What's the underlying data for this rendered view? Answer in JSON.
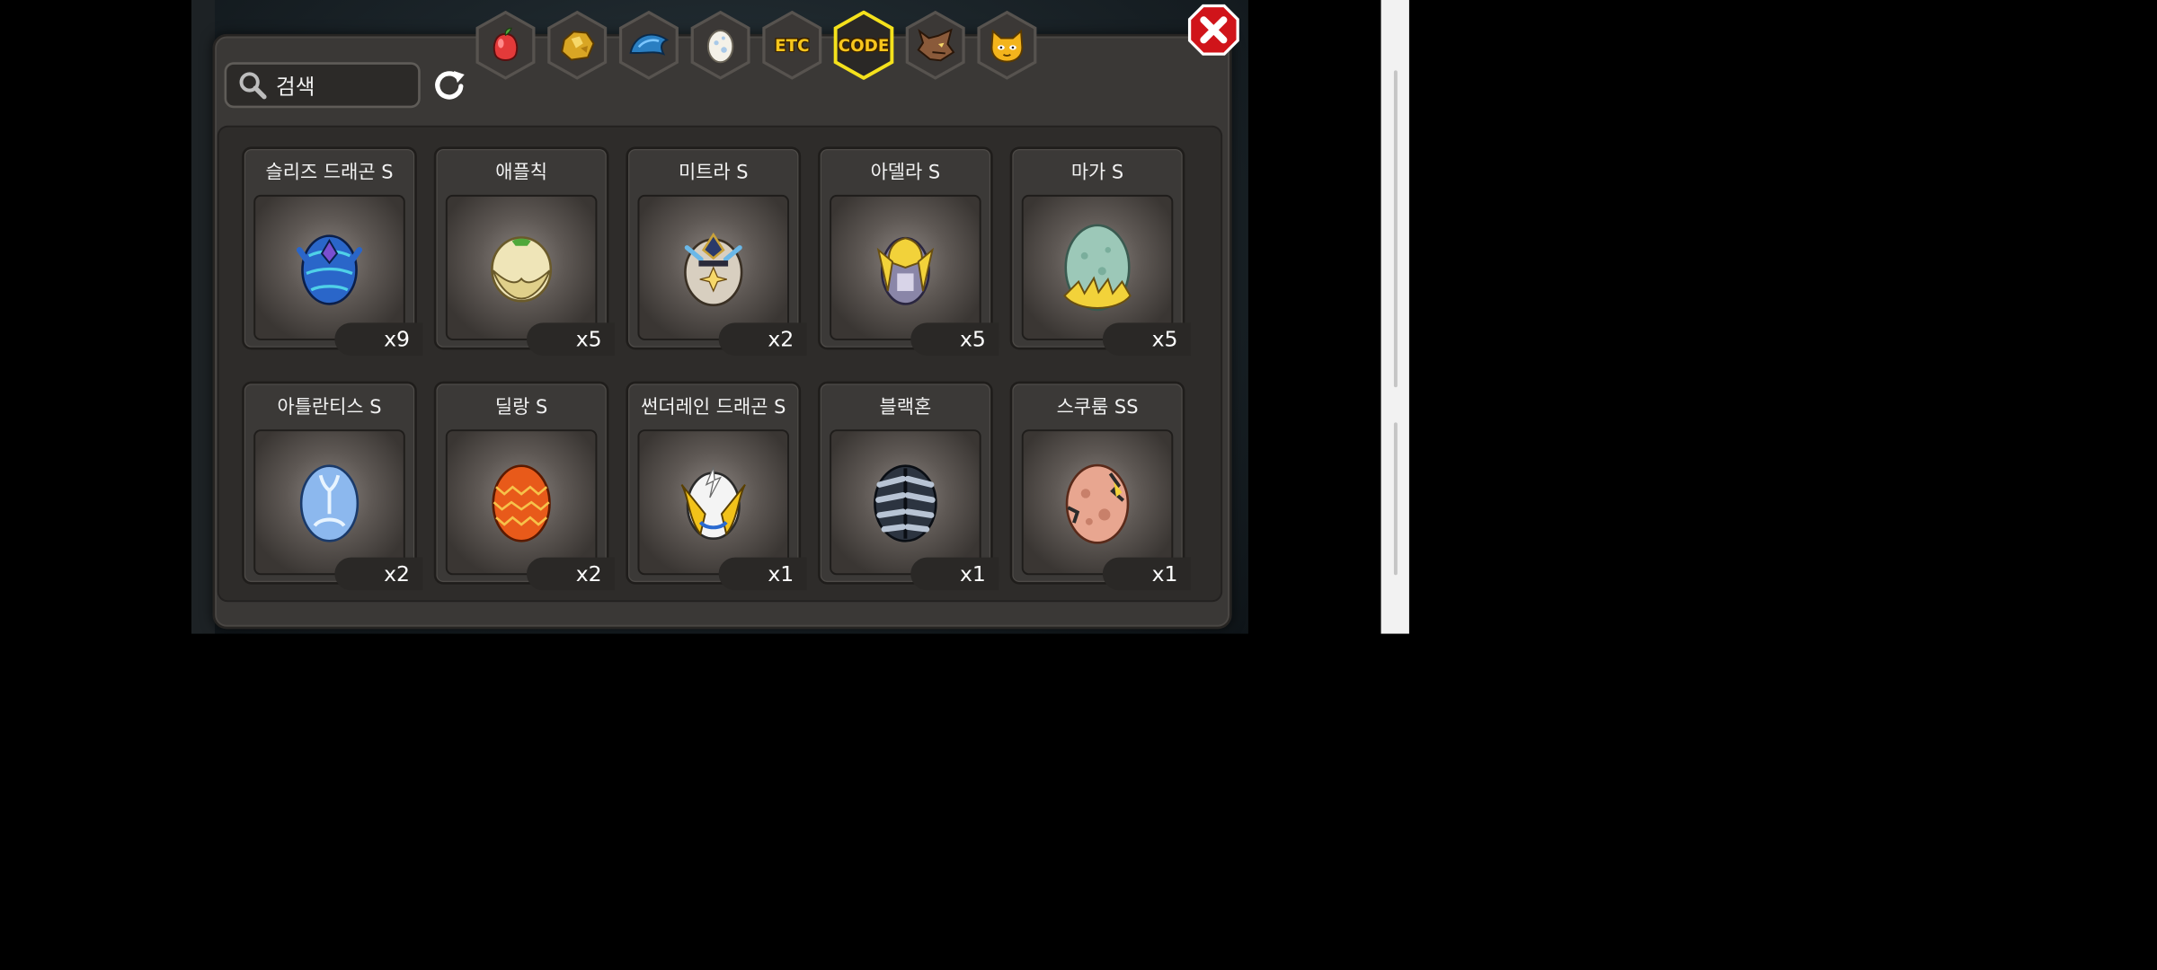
{
  "search": {
    "placeholder": "검색"
  },
  "tabs": [
    {
      "id": "fruit",
      "label": "",
      "icon": "fruit-icon"
    },
    {
      "id": "gold",
      "label": "",
      "icon": "gold-ore-icon"
    },
    {
      "id": "dragon-scale",
      "label": "",
      "icon": "dragon-scale-icon"
    },
    {
      "id": "egg",
      "label": "",
      "icon": "egg-icon"
    },
    {
      "id": "etc",
      "label": "ETC",
      "icon": ""
    },
    {
      "id": "code",
      "label": "CODE",
      "icon": "",
      "selected": true
    },
    {
      "id": "wolf",
      "label": "",
      "icon": "wolf-icon"
    },
    {
      "id": "cat",
      "label": "",
      "icon": "cat-icon"
    }
  ],
  "items": [
    {
      "name": "슬리즈 드래곤 S",
      "qty": "x9"
    },
    {
      "name": "애플칙",
      "qty": "x5"
    },
    {
      "name": "미트라 S",
      "qty": "x2"
    },
    {
      "name": "아델라 S",
      "qty": "x5"
    },
    {
      "name": "마가 S",
      "qty": "x5"
    },
    {
      "name": "아틀란티스 S",
      "qty": "x2"
    },
    {
      "name": "딜랑 S",
      "qty": "x2"
    },
    {
      "name": "썬더레인 드래곤 S",
      "qty": "x1"
    },
    {
      "name": "블랙혼",
      "qty": "x1"
    },
    {
      "name": "스쿠룸 SS",
      "qty": "x1"
    }
  ],
  "colors": {
    "accent": "#f7c61d",
    "close": "#d0141a",
    "panel": "#3a3836"
  }
}
